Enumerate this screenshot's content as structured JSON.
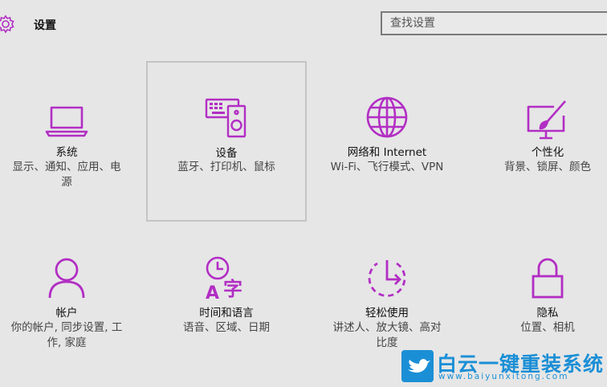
{
  "header": {
    "title": "设置",
    "search_placeholder": "查找设置"
  },
  "accent_color": "#b22ec4",
  "tiles": [
    {
      "icon": "laptop-icon",
      "label": "系统",
      "sub_line1": "显示、通知、应用、电",
      "sub_line2": "源"
    },
    {
      "icon": "devices-icon",
      "label": "设备",
      "sub_line1": "蓝牙、打印机、鼠标",
      "sub_line2": ""
    },
    {
      "icon": "globe-icon",
      "label": "网络和 Internet",
      "sub_line1": "Wi-Fi、飞行模式、VPN",
      "sub_line2": ""
    },
    {
      "icon": "personalization-icon",
      "label": "个性化",
      "sub_line1": "背景、锁屏、颜色",
      "sub_line2": ""
    },
    {
      "icon": "person-icon",
      "label": "帐户",
      "sub_line1": "你的帐户, 同步设置, 工",
      "sub_line2": "作, 家庭"
    },
    {
      "icon": "time-language-icon",
      "label": "时间和语言",
      "sub_line1": "语音、区域、日期",
      "sub_line2": ""
    },
    {
      "icon": "ease-of-access-icon",
      "label": "轻松使用",
      "sub_line1": "讲述人、放大镜、高对",
      "sub_line2": "比度"
    },
    {
      "icon": "lock-icon",
      "label": "隐私",
      "sub_line1": "位置、相机",
      "sub_line2": ""
    }
  ],
  "watermark": {
    "brand": "白云一键重装系统",
    "url": "www.baiyunxitong.com",
    "color": "#1b8fd6"
  }
}
